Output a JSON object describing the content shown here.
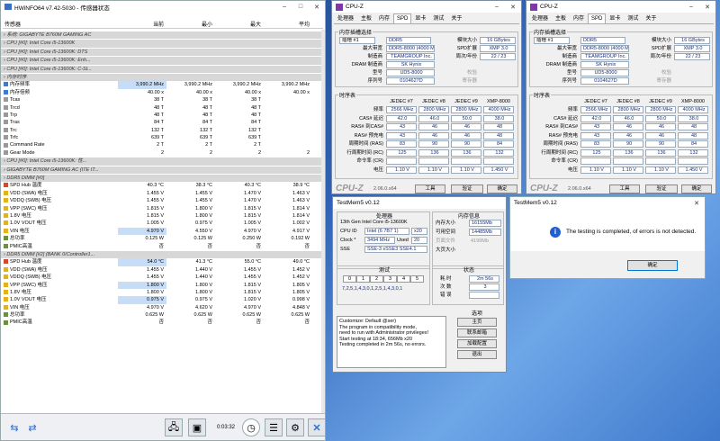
{
  "hwinfo": {
    "title": "HWiNFO64 v7.42-5030 - 传感器状态",
    "cols": [
      "传感器",
      "当前",
      "最小",
      "最大",
      "平均"
    ],
    "rows": [
      {
        "g": 1,
        "n": "系统: GIGABYTE B760M GAMING AC"
      },
      {
        "g": 1,
        "n": "CPU [#0]: Intel Core i5-13600K"
      },
      {
        "g": 1,
        "n": "CPU [#0]: Intel Core i5-13600K: DTS"
      },
      {
        "g": 1,
        "n": "CPU [#0]: Intel Core i5-13600K: Enh..."
      },
      {
        "g": 1,
        "n": "CPU [#0]: Intel Core i5-13600K: C-St..."
      },
      {
        "g": 2,
        "n": "内存时序"
      },
      {
        "n": "内存频率",
        "i": "b",
        "v": [
          "3,990.2 MHz",
          "3,990.2 MHz",
          "3,990.2 MHz",
          "3,990.2 MHz"
        ],
        "h": 1
      },
      {
        "n": "内存倍频",
        "i": "b",
        "v": [
          "40.00 x",
          "40.00 x",
          "40.00 x",
          "40.00 x"
        ]
      },
      {
        "n": "Tcas",
        "v": [
          "38 T",
          "38 T",
          "38 T",
          ""
        ]
      },
      {
        "n": "Trcd",
        "v": [
          "48 T",
          "48 T",
          "48 T",
          ""
        ]
      },
      {
        "n": "Trp",
        "v": [
          "48 T",
          "48 T",
          "48 T",
          ""
        ]
      },
      {
        "n": "Tras",
        "v": [
          "84 T",
          "84 T",
          "84 T",
          ""
        ]
      },
      {
        "n": "Trc",
        "v": [
          "132 T",
          "132 T",
          "132 T",
          ""
        ]
      },
      {
        "n": "Trfc",
        "v": [
          "639 T",
          "639 T",
          "639 T",
          ""
        ]
      },
      {
        "n": "Command Rate",
        "v": [
          "2 T",
          "2 T",
          "2 T",
          ""
        ]
      },
      {
        "n": "Gear Mode",
        "v": [
          "2",
          "2",
          "2",
          "2"
        ]
      },
      {
        "g": 1,
        "n": "CPU [#0]: Intel Core i5-13600K: 性..."
      },
      {
        "g": 1,
        "n": "GIGABYTE B760M GAMING AC (ITE IT..."
      },
      {
        "g": 2,
        "n": "DDR5 DIMM [#0]"
      },
      {
        "n": "SPD Hub 温度",
        "i": "r",
        "v": [
          "40.3 °C",
          "38.3 °C",
          "40.3 °C",
          "38.9 °C"
        ]
      },
      {
        "n": "VDD (SWA) 电压",
        "i": "y",
        "v": [
          "1.455 V",
          "1.455 V",
          "1.470 V",
          "1.463 V"
        ]
      },
      {
        "n": "VDDQ (SWB) 电压",
        "i": "y",
        "v": [
          "1.455 V",
          "1.455 V",
          "1.470 V",
          "1.463 V"
        ]
      },
      {
        "n": "VPP (SWC) 电压",
        "i": "y",
        "v": [
          "1.815 V",
          "1.800 V",
          "1.815 V",
          "1.814 V"
        ]
      },
      {
        "n": "1.8V 电压",
        "i": "y",
        "v": [
          "1.815 V",
          "1.800 V",
          "1.815 V",
          "1.814 V"
        ]
      },
      {
        "n": "1.0V VOUT 电压",
        "i": "y",
        "v": [
          "1.005 V",
          "0.975 V",
          "1.005 V",
          "1.002 V"
        ]
      },
      {
        "n": "VIN 电压",
        "i": "y",
        "v": [
          "4.970 V",
          "4.550 V",
          "4.970 V",
          "4.917 V"
        ],
        "h": 1
      },
      {
        "n": "总功率",
        "i": "g",
        "v": [
          "0.125 W",
          "0.125 W",
          "0.250 W",
          "0.192 W"
        ]
      },
      {
        "n": "PMIC高温",
        "i": "g",
        "v": [
          "否",
          "否",
          "否",
          "否"
        ]
      },
      {
        "g": 2,
        "n": "DDR5 DIMM [#2] (BANK 0/Controller1..."
      },
      {
        "n": "SPD Hub 温度",
        "i": "r",
        "v": [
          "54.0 °C",
          "41.3 °C",
          "55.0 °C",
          "49.0 °C"
        ],
        "h": 1
      },
      {
        "n": "VDD (SWA) 电压",
        "i": "y",
        "v": [
          "1.455 V",
          "1.440 V",
          "1.455 V",
          "1.452 V"
        ]
      },
      {
        "n": "VDDQ (SWB) 电压",
        "i": "y",
        "v": [
          "1.455 V",
          "1.440 V",
          "1.455 V",
          "1.452 V"
        ]
      },
      {
        "n": "VPP (SWC) 电压",
        "i": "y",
        "v": [
          "1.800 V",
          "1.800 V",
          "1.815 V",
          "1.805 V"
        ],
        "h": 1
      },
      {
        "n": "1.8V 电压",
        "i": "y",
        "v": [
          "1.800 V",
          "1.800 V",
          "1.815 V",
          "1.805 V"
        ]
      },
      {
        "n": "1.0V VOUT 电压",
        "i": "y",
        "v": [
          "0.975 V",
          "0.975 V",
          "1.020 V",
          "0.998 V"
        ],
        "h": 1
      },
      {
        "n": "VIN 电压",
        "i": "y",
        "v": [
          "4.970 V",
          "4.620 V",
          "4.970 V",
          "4.848 V"
        ]
      },
      {
        "n": "总功率",
        "i": "g",
        "v": [
          "0.625 W",
          "0.625 W",
          "0.625 W",
          "0.625 W"
        ]
      },
      {
        "n": "PMIC高温",
        "i": "g",
        "v": [
          "否",
          "否",
          "否",
          "否"
        ]
      }
    ],
    "timer": "0:03:32"
  },
  "cpuz": {
    "title": "CPU-Z",
    "tabs": [
      "处理器",
      "主板",
      "内存",
      "SPD",
      "显卡",
      "测试",
      "关于"
    ],
    "active": 3,
    "slot_group": "内存插槽选择",
    "slot": "插槽 #1",
    "type": "DDR5",
    "lbl": [
      "模块大小",
      "SPD扩展",
      "周次/年份",
      "最大带宽",
      "制造商",
      "DRAM 制造商",
      "型号",
      "序列号"
    ],
    "module_size": "16 GBytes",
    "spd_ext": "XMP 3.0",
    "week_year": "22 / 23",
    "max_bw": "DDR5-8000 (4000 MHz)",
    "maker": "TEAMGROUP Inc.",
    "dram_maker": "SK Hynix",
    "part": "UD5-8000",
    "serial": "0104627D",
    "check": "校验",
    "reg": "寄存器",
    "timing_group": "时序表",
    "tcols": [
      "JEDEC #7",
      "JEDEC #8",
      "JEDEC #9",
      "XMP-8000"
    ],
    "trows": [
      [
        "频率",
        "2566 MHz",
        "2800 MHz",
        "2800 MHz",
        "4000 MHz"
      ],
      [
        "CAS# 延迟",
        "42.0",
        "46.0",
        "50.0",
        "38.0"
      ],
      [
        "RAS# 到CAS#",
        "43",
        "46",
        "46",
        "48"
      ],
      [
        "RAS# 预充电",
        "43",
        "46",
        "46",
        "48"
      ],
      [
        "周期时间 (RAS)",
        "83",
        "90",
        "90",
        "84"
      ],
      [
        "行周期时间 (RC)",
        "125",
        "136",
        "136",
        "132"
      ],
      [
        "命令率 (CR)",
        "",
        "",
        "",
        ""
      ],
      [
        "电压",
        "1.10 V",
        "1.10 V",
        "1.10 V",
        "1.450 V"
      ]
    ],
    "ver": "CPU-Z",
    "vernum": "2.06.0.x64",
    "tools": "工具",
    "verify": "验证",
    "ok": "确定"
  },
  "tm": {
    "title": "TestMem5 v0.12",
    "proc_h": "处理器",
    "cpu": "13th Gen Intel Core i5-13600K",
    "cpuid_l": "CPU ID",
    "cpuid": "Intel (6 7B7 1)",
    "x20": "x20",
    "clock_l": "Clock *",
    "clock": "3494 MHz",
    "used_l": "Used",
    "used": "20",
    "sse_l": "SSE",
    "sse": "SSE-3 sSSE3 SSE4.1",
    "mem_h": "内存信息",
    "total_l": "内存大小",
    "total": "16155Mb",
    "free_l": "可用空间",
    "free": "14485Mb",
    "pf_l": "页面文件",
    "pf": "4199Mb",
    "lp_l": "大页大小",
    "test_h": "测试",
    "cells": [
      "0",
      "1",
      "2",
      "3",
      "4",
      "5"
    ],
    "seq": "7,2,5,1,4,3,0,1,2,5,1,4,3,0,1",
    "state_h": "状态",
    "time_l": "耗 时",
    "time": "2m 56s",
    "cycle_l": "次 数",
    "cycle": "3",
    "err_l": "错 误",
    "log": [
      "Customize: Default @ser)",
      "The program in compatibility mode,",
      "need to run with Administrator privileges!",
      "Start testing at 18:34, 656Mb x20",
      "Testing completed in 2m 56s, no errors."
    ],
    "opt_h": "选项",
    "btns": [
      "主页",
      "联系邮箱",
      "加载配置",
      "退出"
    ]
  },
  "dlg": {
    "title": "TestMem5 v0.12",
    "msg": "The testing is completed, of errors is not detected.",
    "ok": "确定"
  }
}
